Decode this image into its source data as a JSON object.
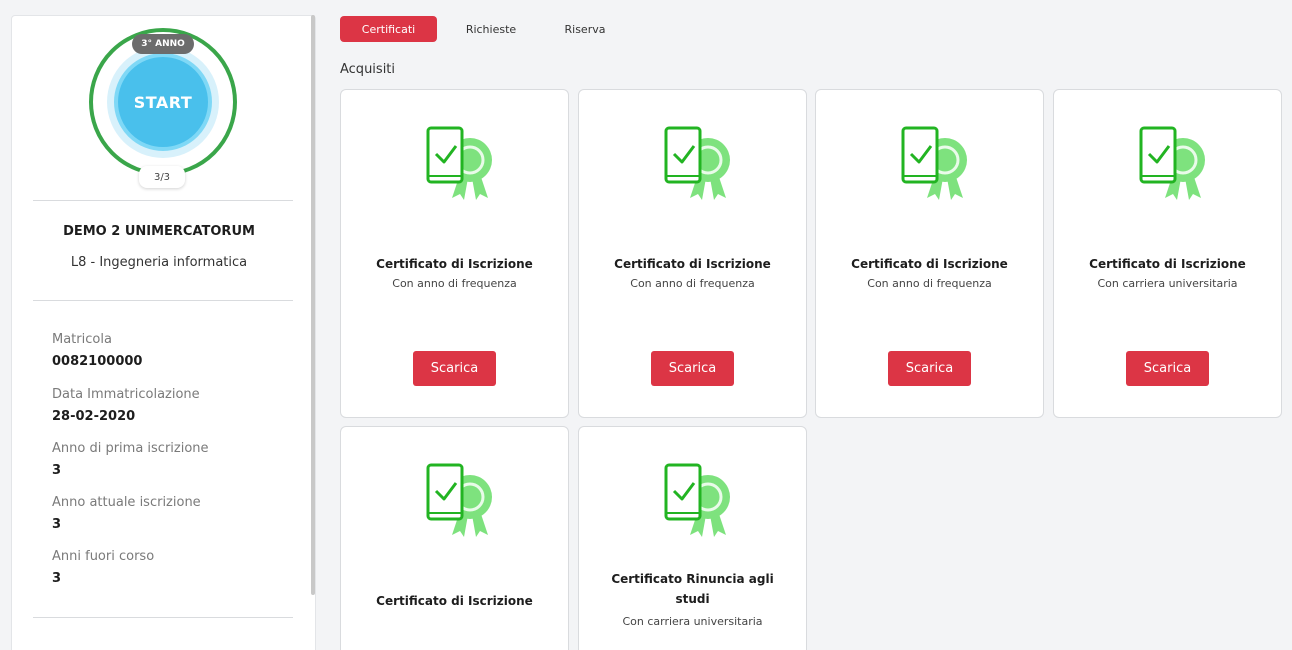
{
  "profile": {
    "year_badge": "3° ANNO",
    "start_label": "START",
    "progress_count": "3/3",
    "name": "DEMO 2 UNIMERCATORUM",
    "course": "L8 - Ingegneria informatica",
    "fields": [
      {
        "label": "Matricola",
        "value": "0082100000"
      },
      {
        "label": "Data Immatricolazione",
        "value": "28-02-2020"
      },
      {
        "label": "Anno di prima iscrizione",
        "value": "3"
      },
      {
        "label": "Anno attuale iscrizione",
        "value": "3"
      },
      {
        "label": "Anni fuori corso",
        "value": "3"
      }
    ]
  },
  "tabs": [
    {
      "label": "Certificati",
      "active": true
    },
    {
      "label": "Richieste",
      "active": false
    },
    {
      "label": "Riserva",
      "active": false
    }
  ],
  "section_title": "Acquisiti",
  "cards": [
    {
      "title": "Certificato di Iscrizione",
      "subtitle": "Con anno di frequenza",
      "button": "Scarica",
      "icon": "certificate-icon"
    },
    {
      "title": "Certificato di Iscrizione",
      "subtitle": "Con anno di frequenza",
      "button": "Scarica",
      "icon": "certificate-icon"
    },
    {
      "title": "Certificato di Iscrizione",
      "subtitle": "Con anno di frequenza",
      "button": "Scarica",
      "icon": "certificate-icon"
    },
    {
      "title": "Certificato di Iscrizione",
      "subtitle": "Con carriera universitaria",
      "button": "Scarica",
      "icon": "certificate-icon"
    },
    {
      "title": "Certificato di Iscrizione",
      "subtitle": "",
      "button": "",
      "icon": "certificate-icon"
    },
    {
      "title": "Certificato Rinuncia agli studi",
      "subtitle": "Con carriera universitaria",
      "button": "",
      "icon": "certificate-icon"
    }
  ],
  "colors": {
    "accent_red": "#dc3545",
    "progress_green": "#3aa64a",
    "start_blue": "#49c0ec",
    "icon_green": "#22b422",
    "icon_light_green": "#7ee27e"
  }
}
